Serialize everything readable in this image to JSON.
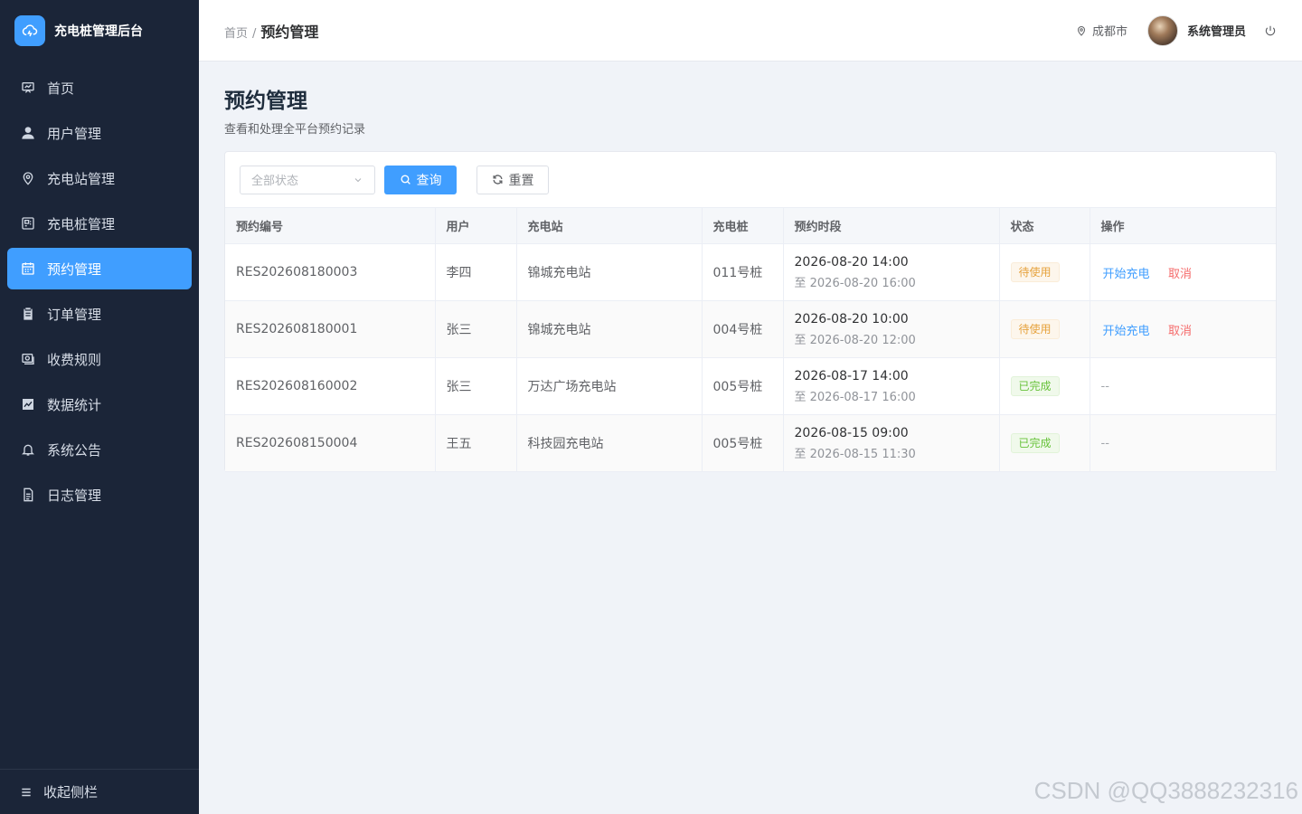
{
  "app": {
    "title": "充电桩管理后台"
  },
  "sidebar": {
    "items": [
      {
        "label": "首页",
        "icon": "dashboard-icon",
        "active": false
      },
      {
        "label": "用户管理",
        "icon": "user-icon",
        "active": false
      },
      {
        "label": "充电站管理",
        "icon": "location-icon",
        "active": false
      },
      {
        "label": "充电桩管理",
        "icon": "charger-icon",
        "active": false
      },
      {
        "label": "预约管理",
        "icon": "calendar-icon",
        "active": true
      },
      {
        "label": "订单管理",
        "icon": "clipboard-icon",
        "active": false
      },
      {
        "label": "收费规则",
        "icon": "money-icon",
        "active": false
      },
      {
        "label": "数据统计",
        "icon": "chart-icon",
        "active": false
      },
      {
        "label": "系统公告",
        "icon": "bell-icon",
        "active": false
      },
      {
        "label": "日志管理",
        "icon": "document-icon",
        "active": false
      }
    ],
    "collapse_label": "收起侧栏"
  },
  "header": {
    "breadcrumb_home": "首页",
    "breadcrumb_sep": "/",
    "breadcrumb_current": "预约管理",
    "location": "成都市",
    "username": "系统管理员"
  },
  "page": {
    "title": "预约管理",
    "subtitle": "查看和处理全平台预约记录"
  },
  "filters": {
    "status_placeholder": "全部状态",
    "search_label": "查询",
    "reset_label": "重置"
  },
  "table": {
    "columns": [
      "预约编号",
      "用户",
      "充电站",
      "充电桩",
      "预约时段",
      "状态",
      "操作"
    ],
    "rows": [
      {
        "id": "RES202608180003",
        "user": "李四",
        "station": "锦城充电站",
        "pile": "011号桩",
        "start": "2026-08-20 14:00",
        "end": "至 2026-08-20 16:00",
        "status": "待使用",
        "status_type": "warning",
        "action_start": "开始充电",
        "action_cancel": "取消",
        "action_none": ""
      },
      {
        "id": "RES202608180001",
        "user": "张三",
        "station": "锦城充电站",
        "pile": "004号桩",
        "start": "2026-08-20 10:00",
        "end": "至 2026-08-20 12:00",
        "status": "待使用",
        "status_type": "warning",
        "action_start": "开始充电",
        "action_cancel": "取消",
        "action_none": ""
      },
      {
        "id": "RES202608160002",
        "user": "张三",
        "station": "万达广场充电站",
        "pile": "005号桩",
        "start": "2026-08-17 14:00",
        "end": "至 2026-08-17 16:00",
        "status": "已完成",
        "status_type": "success",
        "action_start": "",
        "action_cancel": "",
        "action_none": "--"
      },
      {
        "id": "RES202608150004",
        "user": "王五",
        "station": "科技园充电站",
        "pile": "005号桩",
        "start": "2026-08-15 09:00",
        "end": "至 2026-08-15 11:30",
        "status": "已完成",
        "status_type": "success",
        "action_start": "",
        "action_cancel": "",
        "action_none": "--"
      }
    ]
  },
  "watermark": "CSDN @QQ3888232316",
  "colors": {
    "primary": "#409eff",
    "sidebar_bg": "#1b2538",
    "warning": "#e6a23c",
    "success": "#67c23a",
    "danger": "#f56c6c"
  }
}
